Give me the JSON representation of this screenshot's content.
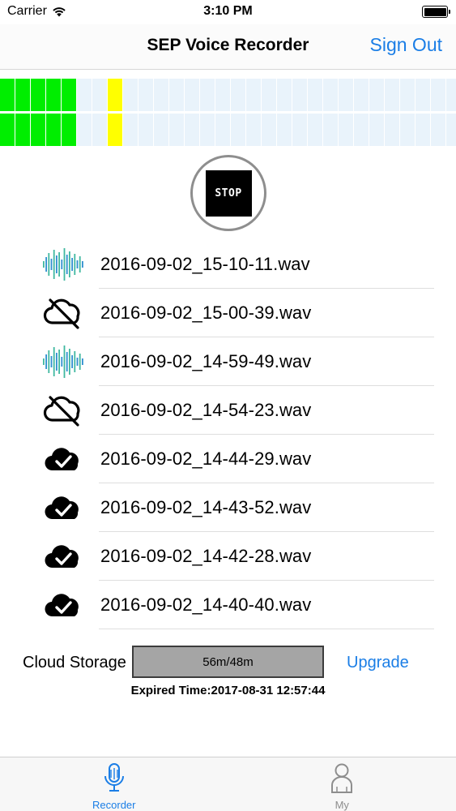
{
  "status_bar": {
    "carrier": "Carrier",
    "time": "3:10 PM"
  },
  "nav": {
    "title": "SEP Voice Recorder",
    "sign_out": "Sign Out"
  },
  "meter": {
    "green_color": "#00ee00",
    "yellow_color": "#ffff00",
    "empty_color": "#e9f3fb",
    "cells_per_row": 30,
    "rows": [
      [
        "green",
        "green",
        "green",
        "green",
        "green",
        "empty",
        "empty",
        "yellow",
        "empty",
        "empty",
        "empty",
        "empty",
        "empty",
        "empty",
        "empty",
        "empty",
        "empty",
        "empty",
        "empty",
        "empty",
        "empty",
        "empty",
        "empty",
        "empty",
        "empty",
        "empty",
        "empty",
        "empty",
        "empty",
        "empty"
      ],
      [
        "green",
        "green",
        "green",
        "green",
        "green",
        "empty",
        "empty",
        "yellow",
        "empty",
        "empty",
        "empty",
        "empty",
        "empty",
        "empty",
        "empty",
        "empty",
        "empty",
        "empty",
        "empty",
        "empty",
        "empty",
        "empty",
        "empty",
        "empty",
        "empty",
        "empty",
        "empty",
        "empty",
        "empty",
        "empty"
      ]
    ]
  },
  "record_button": {
    "label": "STOP"
  },
  "recordings": [
    {
      "name": "2016-09-02_15-10-11.wav",
      "icon": "waveform-icon"
    },
    {
      "name": "2016-09-02_15-00-39.wav",
      "icon": "cloud-off-icon"
    },
    {
      "name": "2016-09-02_14-59-49.wav",
      "icon": "waveform-icon"
    },
    {
      "name": "2016-09-02_14-54-23.wav",
      "icon": "cloud-off-icon"
    },
    {
      "name": "2016-09-02_14-44-29.wav",
      "icon": "cloud-check-icon"
    },
    {
      "name": "2016-09-02_14-43-52.wav",
      "icon": "cloud-check-icon"
    },
    {
      "name": "2016-09-02_14-42-28.wav",
      "icon": "cloud-check-icon"
    },
    {
      "name": "2016-09-02_14-40-40.wav",
      "icon": "cloud-check-icon"
    },
    {
      "name": "",
      "icon": "cloud-check-icon"
    }
  ],
  "storage": {
    "label": "Cloud Storage",
    "usage_text": "56m/48m",
    "usage_fraction": 1.0,
    "upgrade": "Upgrade",
    "expired": "Expired Time:2017-08-31 12:57:44"
  },
  "tabs": [
    {
      "label": "Recorder",
      "icon": "microphone-icon",
      "active": true
    },
    {
      "label": "My",
      "icon": "person-icon",
      "active": false
    }
  ],
  "colors": {
    "accent": "#1b7ee6"
  }
}
